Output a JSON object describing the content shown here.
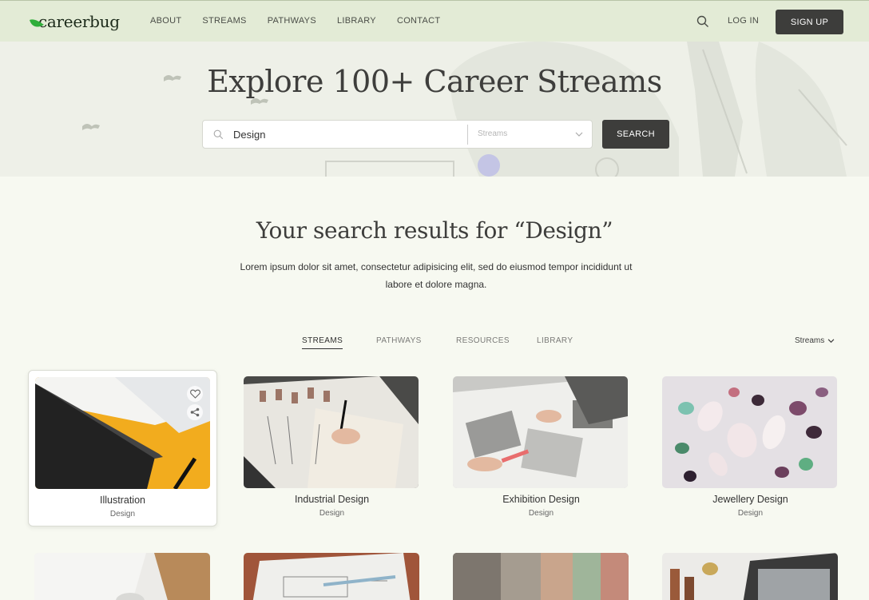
{
  "nav": {
    "logo": "careerbug",
    "links": [
      "ABOUT",
      "STREAMS",
      "PATHWAYS",
      "LIBRARY",
      "CONTACT"
    ],
    "login": "LOG IN",
    "signup": "SIGN UP"
  },
  "hero": {
    "title": "Explore 100+ Career Streams",
    "search_value": "Design",
    "streams_placeholder": "Streams",
    "search_button": "SEARCH"
  },
  "results": {
    "title": "Your search results for “Design”",
    "description": "Lorem ipsum dolor sit amet, consectetur adipisicing elit, sed do eiusmod tempor incididunt ut labore et dolore magna.",
    "tabs": [
      "STREAMS",
      "PATHWAYS",
      "RESOURCES",
      "LIBRARY"
    ],
    "sort": "Streams"
  },
  "cards": [
    {
      "title": "Illustration",
      "category": "Design"
    },
    {
      "title": "Industrial Design",
      "category": "Design"
    },
    {
      "title": "Exhibition Design",
      "category": "Design"
    },
    {
      "title": "Jewellery Design",
      "category": "Design"
    }
  ],
  "colors": {
    "nav_bg": "#e3ebd6",
    "hero_bg": "#eef0e8",
    "page_bg": "#f7f9f1",
    "button_dark": "#3d3d3b",
    "logo_leaf": "#2fae3a"
  },
  "icons": {
    "logo": "leaf-icon",
    "nav_search": "search-icon",
    "field_search": "search-icon",
    "select": "chevron-down-icon",
    "sort": "chevron-down-icon",
    "favorite": "heart-icon",
    "share": "share-icon"
  }
}
